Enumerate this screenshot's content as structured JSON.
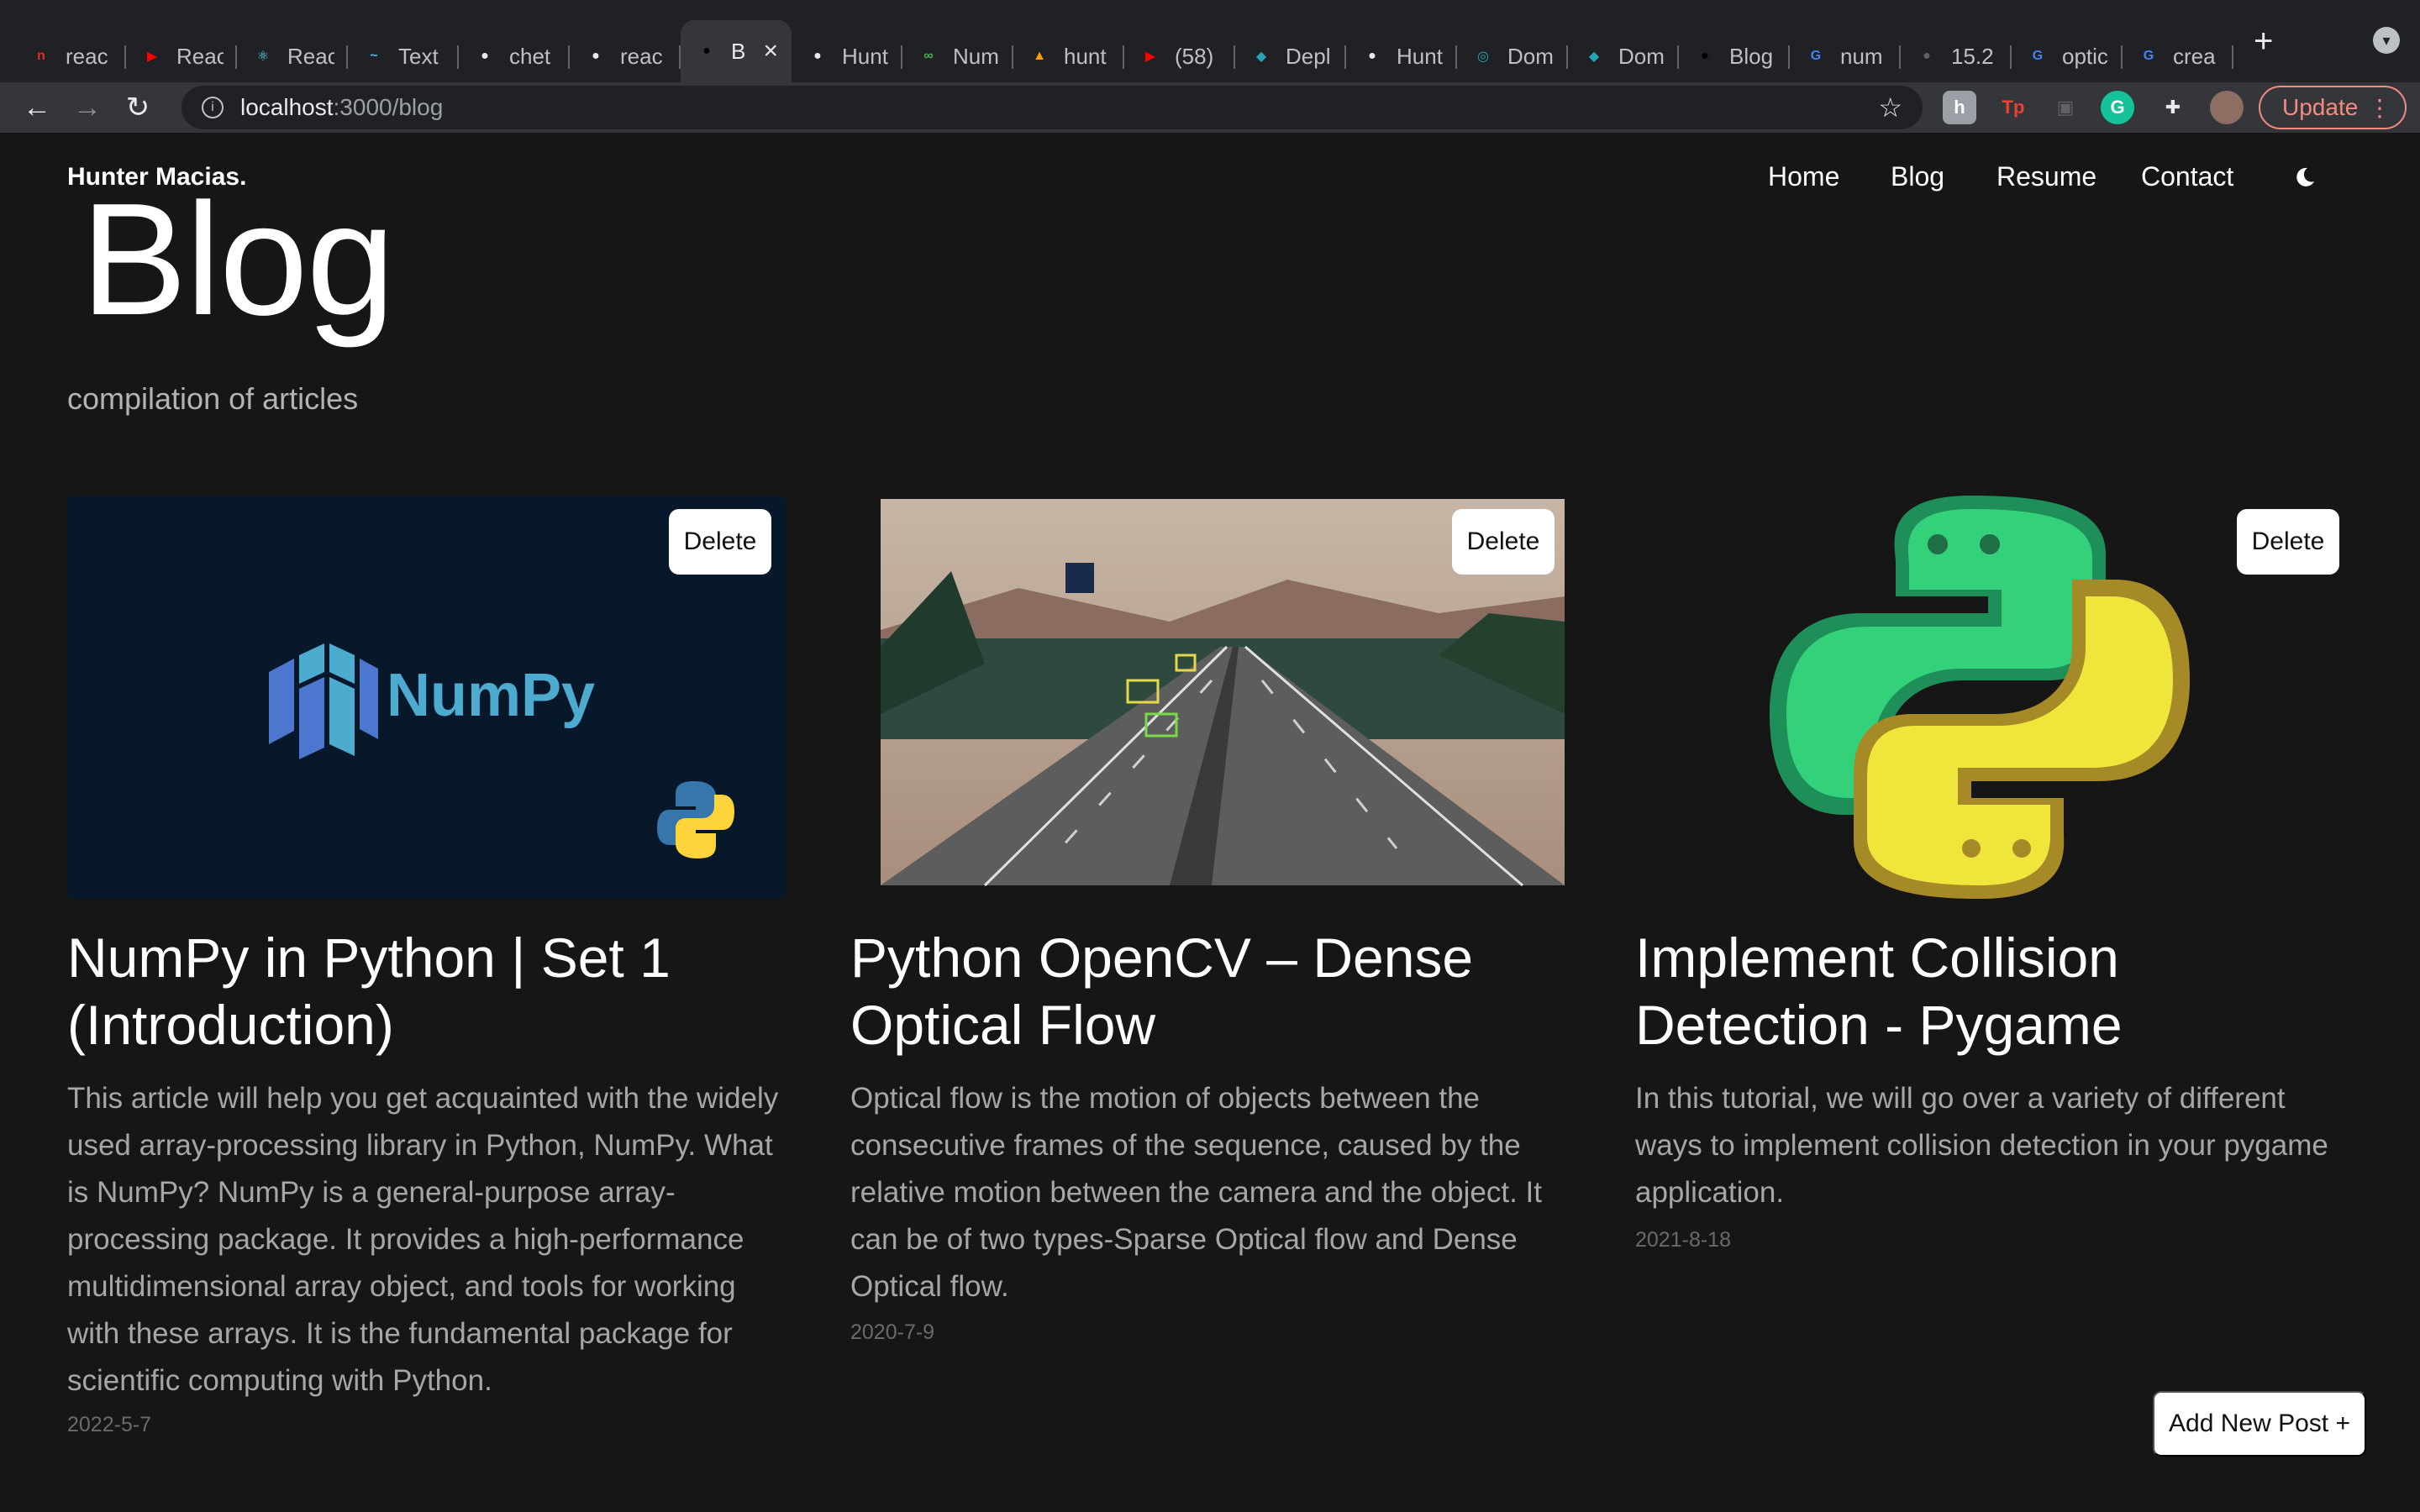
{
  "browser": {
    "tabs": [
      {
        "title": "reac",
        "color": "#e52d27",
        "glyph": "n"
      },
      {
        "title": "Reac",
        "color": "#ff0000",
        "glyph": "▶"
      },
      {
        "title": "Reac",
        "color": "#61dafb",
        "glyph": "⚛"
      },
      {
        "title": "Text",
        "color": "#38bdf8",
        "glyph": "~"
      },
      {
        "title": "chet",
        "color": "#e8eaed",
        "glyph": "●"
      },
      {
        "title": "reac",
        "color": "#e8eaed",
        "glyph": "●"
      },
      {
        "title": "B",
        "color": "#000000",
        "glyph": "●",
        "active": true
      },
      {
        "title": "Hunt",
        "color": "#e8eaed",
        "glyph": "●"
      },
      {
        "title": "Num",
        "color": "#4caf50",
        "glyph": "∞"
      },
      {
        "title": "hunt",
        "color": "#ffa000",
        "glyph": "▲"
      },
      {
        "title": "(58)",
        "color": "#ff0000",
        "glyph": "▶"
      },
      {
        "title": "Depl",
        "color": "#26a5b8",
        "glyph": "◆"
      },
      {
        "title": "Hunt",
        "color": "#e8eaed",
        "glyph": "●"
      },
      {
        "title": "Dom",
        "color": "#26a5b8",
        "glyph": "◎"
      },
      {
        "title": "Dom",
        "color": "#26a5b8",
        "glyph": "◆"
      },
      {
        "title": "Blog",
        "color": "#000000",
        "glyph": "●"
      },
      {
        "title": "num",
        "color": "#4285f4",
        "glyph": "G"
      },
      {
        "title": "15.2",
        "color": "#5f6368",
        "glyph": "●"
      },
      {
        "title": "optic",
        "color": "#4285f4",
        "glyph": "G"
      },
      {
        "title": "crea",
        "color": "#4285f4",
        "glyph": "G"
      }
    ],
    "new_tab": "+",
    "url_host": "localhost",
    "url_path": ":3000/blog",
    "update_label": "Update"
  },
  "site": {
    "name": "Hunter Macias.",
    "nav": [
      "Home",
      "Blog",
      "Resume",
      "Contact"
    ],
    "title": "Blog",
    "subtitle": "compilation of articles"
  },
  "posts": [
    {
      "title": "NumPy in Python | Set 1 (Introduction)",
      "description": "This article will help you get acquainted with the widely used array-processing library in Python, NumPy. What is NumPy? NumPy is a general-purpose array-processing package. It provides a high-performance multidimensional array object, and tools for working with these arrays. It is the fundamental package for scientific computing with Python.",
      "date": "2022-5-7",
      "image_label": "NumPy",
      "delete_label": "Delete"
    },
    {
      "title": "Python OpenCV – Dense Optical Flow",
      "description": "Optical flow is the motion of objects between the consecutive frames of the sequence, caused by the relative motion between the camera and the object. It can be of two types-Sparse Optical flow and Dense Optical flow.",
      "date": "2020-7-9",
      "delete_label": "Delete"
    },
    {
      "title": "Implement Collision Detection - Pygame",
      "description": "In this tutorial, we will go over a variety of different ways to implement collision detection in your pygame application.",
      "date": "2021-8-18",
      "delete_label": "Delete"
    }
  ],
  "add_post_label": "Add New Post +"
}
